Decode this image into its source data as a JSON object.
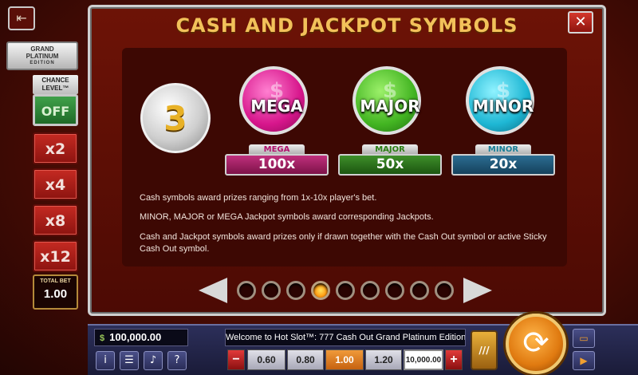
{
  "title": "CASH AND JACKPOT SYMBOLS",
  "left": {
    "edition": {
      "line1": "GRAND",
      "line2": "PLATINUM",
      "line3": "EDITION"
    },
    "chance_label": "CHANCE LEVEL™",
    "options": [
      "OFF",
      "x2",
      "x4",
      "x8",
      "x12"
    ],
    "total_bet_label": "TOTAL BET",
    "total_bet_value": "1.00"
  },
  "symbols": {
    "cash_number": "3",
    "coins": [
      "MEGA",
      "MAJOR",
      "MINOR"
    ],
    "jackpots": [
      {
        "name": "MEGA",
        "amount": "100x"
      },
      {
        "name": "MAJOR",
        "amount": "50x"
      },
      {
        "name": "MINOR",
        "amount": "20x"
      }
    ]
  },
  "description": [
    "Cash symbols award prizes ranging from 1x-10x player's bet.",
    "MINOR, MAJOR or MEGA Jackpot symbols award corresponding Jackpots.",
    "Cash and Jackpot symbols award prizes only if drawn together with the Cash Out symbol or active Sticky Cash Out symbol."
  ],
  "pager": {
    "total": 9,
    "active": 4
  },
  "bottom": {
    "balance": "100,000.00",
    "ticker": "Welcome to Hot Slot™: 777 Cash Out Grand Platinum Edition",
    "stakes": [
      "0.60",
      "0.80",
      "1.00",
      "1.20",
      "10,000.00"
    ],
    "selected_stake": "1.00"
  },
  "colors": {
    "title": "#f2c15a",
    "mega": "#d7168c",
    "major": "#43b522",
    "minor": "#1eb7d4"
  }
}
